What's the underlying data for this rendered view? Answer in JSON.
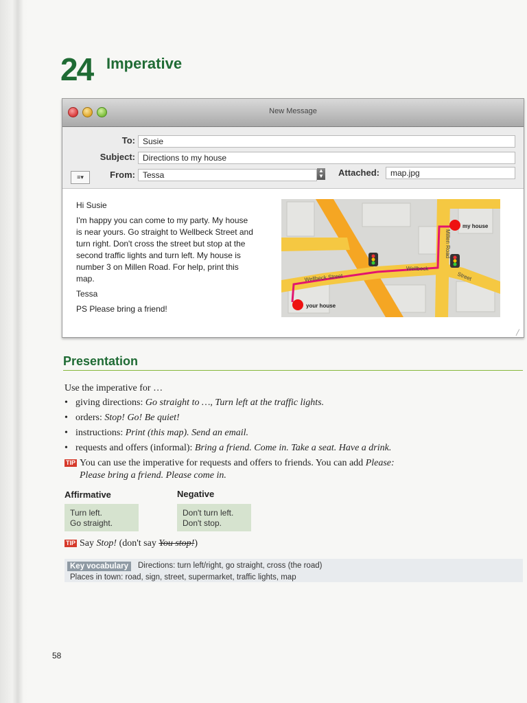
{
  "unit": {
    "number": "24",
    "title": "Imperative"
  },
  "email": {
    "window_title": "New Message",
    "to_label": "To:",
    "to_value": "Susie",
    "subject_label": "Subject:",
    "subject_value": "Directions to my house",
    "from_label": "From:",
    "from_value": "Tessa",
    "attached_label": "Attached:",
    "attached_value": "map.jpg",
    "menu_glyph": "≡▾",
    "body": [
      "Hi Susie",
      "I'm happy you can come to my party. My house is near yours. Go straight to Wellbeck Street and turn right. Don't cross the street but stop at the second traffic lights and turn left. My house is number 3 on Millen Road. For help, print this map.",
      "Tessa",
      "PS Please bring a friend!"
    ]
  },
  "map": {
    "my_house": "my house",
    "your_house": "your house",
    "street1": "Wellbeck Street",
    "street2a": "Wellbeck",
    "street2b": "Street",
    "road": "Millen Road"
  },
  "presentation": {
    "title": "Presentation",
    "intro": "Use the imperative for …",
    "bullets": [
      {
        "label": "giving directions: ",
        "example": "Go straight to …, Turn left at the traffic lights."
      },
      {
        "label": "orders: ",
        "example": "Stop! Go! Be quiet!"
      },
      {
        "label": "instructions: ",
        "example": "Print (this map). Send an email."
      },
      {
        "label": "requests and offers (informal): ",
        "example": "Bring a friend. Come in. Take a seat. Have a drink."
      }
    ],
    "tip_badge": "TIP",
    "tip1_text": "You can use the imperative for requests and offers to friends. You can add ",
    "tip1_please": "Please:",
    "tip1_example": "Please bring a friend. Please come in.",
    "affirmative_heading": "Affirmative",
    "negative_heading": "Negative",
    "affirmative": [
      "Turn left.",
      "Go straight."
    ],
    "negative": [
      "Don't turn left.",
      "Don't stop."
    ],
    "tip2_say": "Say ",
    "tip2_stop": "Stop!",
    "tip2_mid": " (don't say ",
    "tip2_wrong": "You stop!",
    "tip2_end": ")"
  },
  "vocab": {
    "badge": "Key vocabulary",
    "line1": "Directions: turn left/right, go straight, cross (the road)",
    "line2": "Places in town: road, sign, street, supermarket, traffic lights, map"
  },
  "page_number": "58",
  "colors": {
    "green_heading": "#1f6b34",
    "tip_red": "#d63a2b",
    "box_green": "#d6e3cf",
    "route_pink": "#e2156e"
  }
}
